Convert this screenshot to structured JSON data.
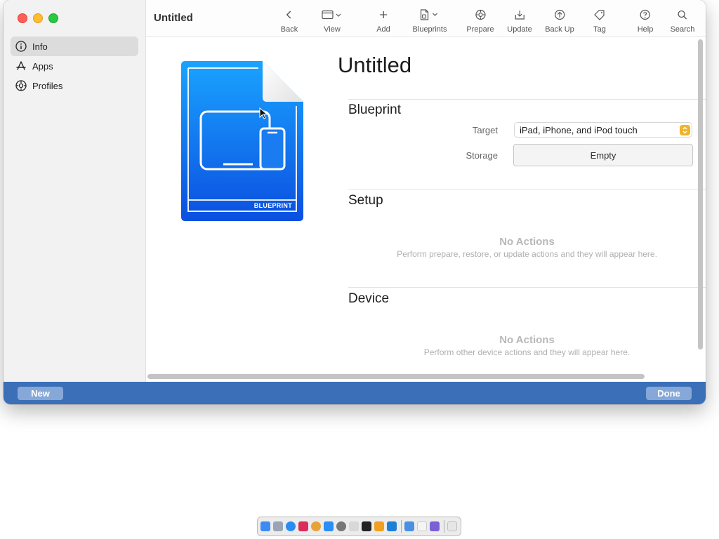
{
  "window": {
    "title": "Untitled"
  },
  "sidebar": {
    "items": [
      {
        "label": "Info",
        "icon": "info-circle-icon",
        "selected": true
      },
      {
        "label": "Apps",
        "icon": "app-store-icon",
        "selected": false
      },
      {
        "label": "Profiles",
        "icon": "gear-badge-icon",
        "selected": false
      }
    ]
  },
  "toolbar": {
    "back": "Back",
    "view": "View",
    "add": "Add",
    "blueprints": "Blueprints",
    "prepare": "Prepare",
    "update": "Update",
    "back_up": "Back Up",
    "tag": "Tag",
    "help": "Help",
    "search": "Search"
  },
  "document": {
    "title": "Untitled",
    "icon_label": "BLUEPRINT"
  },
  "blueprint": {
    "heading": "Blueprint",
    "target_label": "Target",
    "target_value": "iPad, iPhone, and iPod touch",
    "storage_label": "Storage",
    "storage_value": "Empty"
  },
  "setup": {
    "heading": "Setup",
    "empty_title": "No Actions",
    "empty_message": "Perform prepare, restore, or update actions and they will appear here."
  },
  "device": {
    "heading": "Device",
    "empty_title": "No Actions",
    "empty_message": "Perform other device actions and they will appear here."
  },
  "footer": {
    "new_label": "New",
    "done_label": "Done"
  },
  "colors": {
    "accent_blue": "#1a7cf0",
    "footer_bar": "#3b6fb8",
    "stepper": "#f0b429"
  }
}
